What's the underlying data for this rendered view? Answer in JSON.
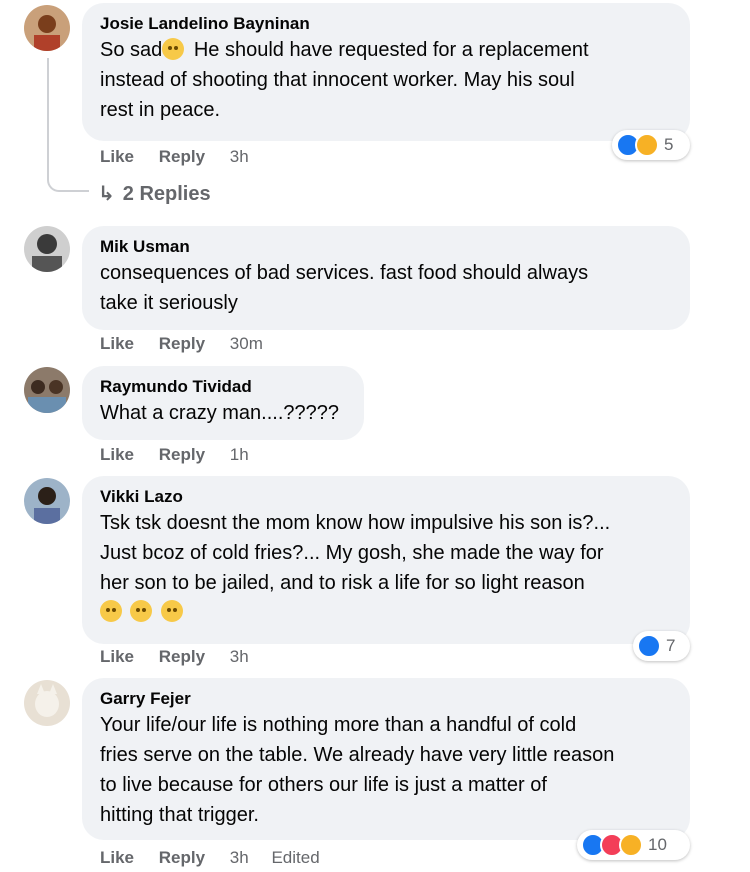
{
  "comments": [
    {
      "name": "Josie Landelino Bayninan",
      "text_before_emoji": "So sad",
      "emoji": "crying-face",
      "text_after": " He should have requested for a replacement\ninstead of shooting that innocent worker. May his soul\nrest in peace.",
      "actions": {
        "like": "Like",
        "reply": "Reply",
        "time": "3h"
      },
      "reactions": {
        "icons": [
          "like",
          "care"
        ],
        "count": "5"
      },
      "replies_label": "2 Replies"
    },
    {
      "name": "Mik Usman",
      "text": "consequences of bad services. fast food should always\ntake it seriously",
      "actions": {
        "like": "Like",
        "reply": "Reply",
        "time": "30m"
      }
    },
    {
      "name": "Raymundo Tividad",
      "text": "What a crazy man....?????",
      "actions": {
        "like": "Like",
        "reply": "Reply",
        "time": "1h"
      }
    },
    {
      "name": "Vikki Lazo",
      "text": "Tsk tsk doesnt the mom know how impulsive his son is?...\nJust bcoz of cold fries?... My gosh, she made the way for\nher son to be jailed, and to risk a life for so light reason",
      "emojis": [
        "rolling-eyes-face",
        "sad-face",
        "confused-face"
      ],
      "actions": {
        "like": "Like",
        "reply": "Reply",
        "time": "3h"
      },
      "reactions": {
        "icons": [
          "like"
        ],
        "count": "7"
      }
    },
    {
      "name": "Garry Fejer",
      "text": "Your life/our life is nothing more than a handful of cold\nfries serve on the table. We already have very little reason\nto live because for others our life is just a matter of\nhitting that trigger.",
      "actions": {
        "like": "Like",
        "reply": "Reply",
        "time": "3h",
        "edited": "Edited"
      },
      "reactions": {
        "icons": [
          "like",
          "love",
          "wow"
        ],
        "count": "10"
      }
    }
  ],
  "colors": {
    "bubble": "#f0f2f5",
    "secondary_text": "#65676b",
    "like_blue": "#1877f2",
    "love_red": "#f33e58",
    "wow_yellow": "#f7b125"
  }
}
